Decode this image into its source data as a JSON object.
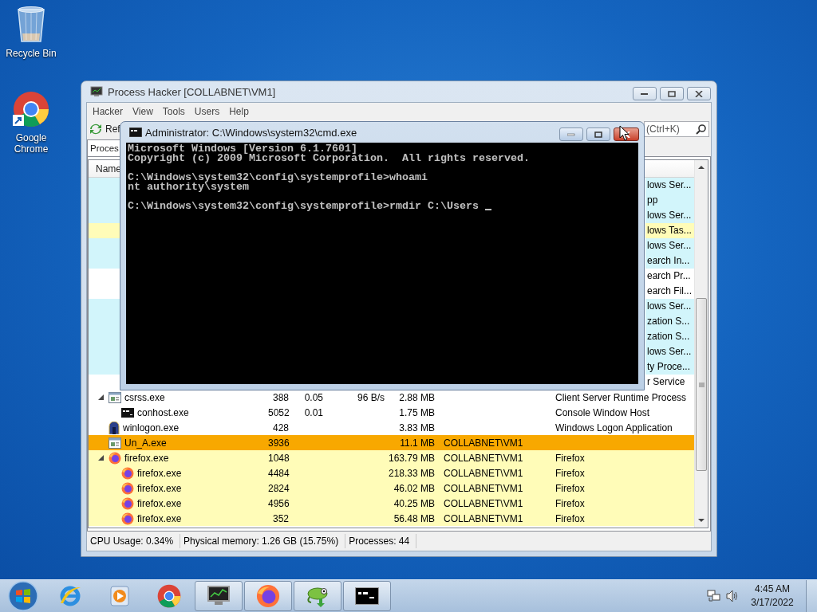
{
  "desktop_icons": [
    {
      "label": "Recycle Bin",
      "kind": "recycle_bin"
    },
    {
      "label": "Google Chrome",
      "kind": "chrome"
    }
  ],
  "process_hacker": {
    "title": "Process Hacker [COLLABNET\\VM1]",
    "menu": [
      "Hacker",
      "View",
      "Tools",
      "Users",
      "Help"
    ],
    "refresh_button": "Ref",
    "search": {
      "placeholder": "(Ctrl+K)"
    },
    "tab": "Proces",
    "name_header": "Name",
    "hidden_rows": [
      {
        "description": "lows Ser...",
        "color": "#d2f5fb"
      },
      {
        "description": "pp",
        "color": "#d2f5fb"
      },
      {
        "description": "lows Ser...",
        "color": "#d2f5fb"
      },
      {
        "description": "lows Tas...",
        "color": "#fffcb8"
      },
      {
        "description": "lows Ser...",
        "color": "#d2f5fb"
      },
      {
        "description": "earch In...",
        "color": "#d2f5fb"
      },
      {
        "description": "earch Pr...",
        "color": "#ffffff"
      },
      {
        "description": "earch Fil...",
        "color": "#ffffff"
      },
      {
        "description": "lows Ser...",
        "color": "#d2f5fb"
      },
      {
        "description": "zation S...",
        "color": "#d2f5fb"
      },
      {
        "description": "zation S...",
        "color": "#d2f5fb"
      },
      {
        "description": "lows Ser...",
        "color": "#d2f5fb"
      },
      {
        "description": "ty Proce...",
        "color": "#d2f5fb"
      },
      {
        "description": "r Service",
        "color": "#ffffff"
      }
    ],
    "rows": [
      {
        "name": "csrss.exe",
        "pid": "388",
        "cpu": "0.05",
        "io": "96 B/s",
        "private": "2.88 MB",
        "description": "Client Server Runtime Process",
        "kind": "app",
        "color": "#ffffff",
        "expanded": true,
        "children": [
          {
            "name": "conhost.exe",
            "pid": "5052",
            "cpu": "0.01",
            "private": "1.75 MB",
            "description": "Console Window Host",
            "kind": "console",
            "color": "#ffffff"
          }
        ]
      },
      {
        "name": "winlogon.exe",
        "pid": "428",
        "private": "3.83 MB",
        "description": "Windows Logon Application",
        "kind": "logon",
        "color": "#ffffff"
      },
      {
        "name": "Un_A.exe",
        "pid": "3936",
        "private": "11.1 MB",
        "user": "COLLABNET\\VM1",
        "kind": "app",
        "color": "#f8a800"
      },
      {
        "name": "firefox.exe",
        "pid": "1048",
        "private": "163.79 MB",
        "user": "COLLABNET\\VM1",
        "description": "Firefox",
        "kind": "browser",
        "color": "#fffcb8",
        "expanded": true,
        "children": [
          {
            "name": "firefox.exe",
            "pid": "4484",
            "private": "218.33 MB",
            "user": "COLLABNET\\VM1",
            "description": "Firefox",
            "kind": "browser",
            "color": "#fffcb8"
          },
          {
            "name": "firefox.exe",
            "pid": "2824",
            "private": "46.02 MB",
            "user": "COLLABNET\\VM1",
            "description": "Firefox",
            "kind": "browser",
            "color": "#fffcb8"
          },
          {
            "name": "firefox.exe",
            "pid": "4956",
            "private": "40.25 MB",
            "user": "COLLABNET\\VM1",
            "description": "Firefox",
            "kind": "browser",
            "color": "#fffcb8"
          },
          {
            "name": "firefox.exe",
            "pid": "352",
            "private": "56.48 MB",
            "user": "COLLABNET\\VM1",
            "description": "Firefox",
            "kind": "browser",
            "color": "#fffcb8"
          }
        ]
      }
    ],
    "status_bar": [
      "CPU Usage: 0.34%",
      "Physical memory: 1.26 GB (15.75%)",
      "Processes: 44"
    ]
  },
  "console": {
    "title": "Administrator: C:\\Windows\\system32\\cmd.exe",
    "blocks": [
      [
        "Microsoft Windows [Version 6.1.7601]",
        "Copyright (c) 2009 Microsoft Corporation.  All rights reserved."
      ],
      [
        "C:\\Windows\\system32\\config\\systemprofile>whoami",
        "nt authority\\system"
      ],
      [
        "C:\\Windows\\system32\\config\\systemprofile>rmdir C:\\Users "
      ]
    ],
    "cursor": true
  },
  "taskbar": {
    "items": [
      {
        "kind": "ie",
        "running": false
      },
      {
        "kind": "media",
        "running": false
      },
      {
        "kind": "chrome",
        "running": false
      },
      {
        "kind": "process_hacker",
        "running": true
      },
      {
        "kind": "firefox",
        "running": true
      },
      {
        "kind": "chameleon",
        "running": true
      },
      {
        "kind": "cmd",
        "running": true
      }
    ],
    "clock": {
      "time": "4:45 AM",
      "date": "3/17/2022"
    }
  }
}
